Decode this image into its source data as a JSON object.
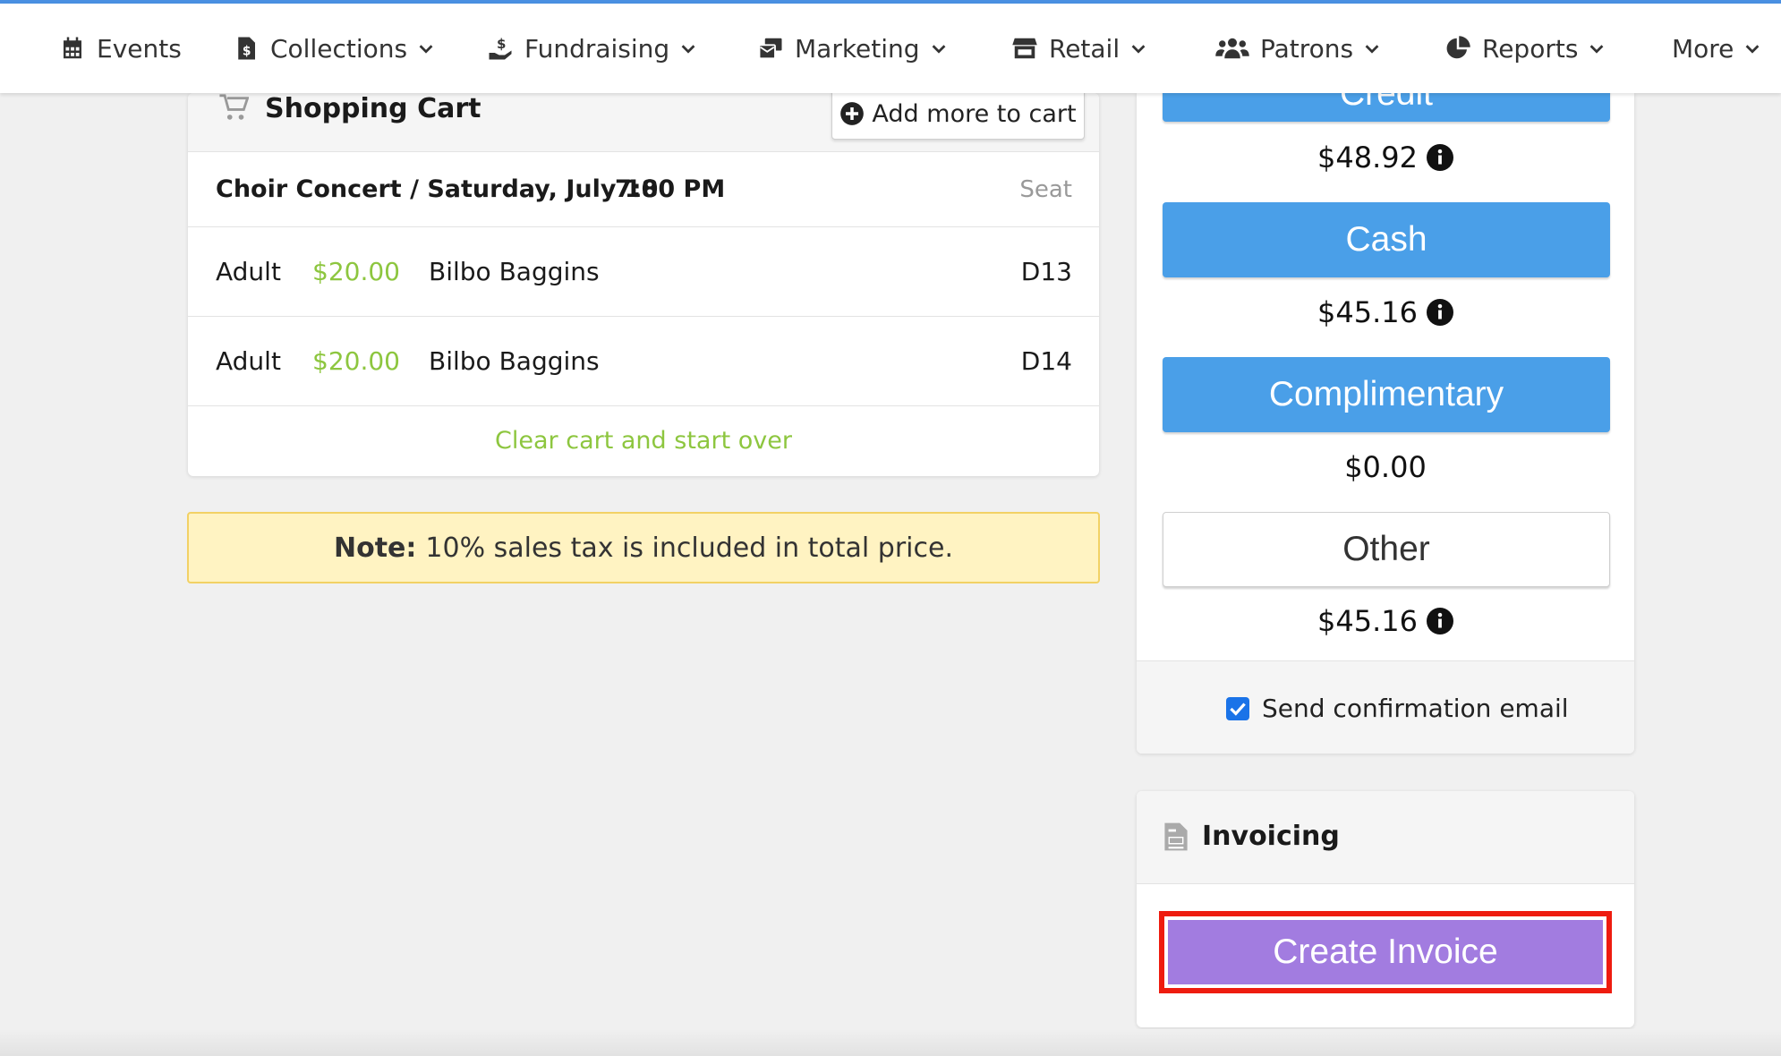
{
  "nav": {
    "items": [
      {
        "label": "Events",
        "icon": "calendar-icon"
      },
      {
        "label": "Collections",
        "icon": "dollar-file-icon"
      },
      {
        "label": "Fundraising",
        "icon": "donate-hand-icon"
      },
      {
        "label": "Marketing",
        "icon": "mail-bulk-icon"
      },
      {
        "label": "Retail",
        "icon": "store-icon"
      },
      {
        "label": "Patrons",
        "icon": "users-icon"
      },
      {
        "label": "Reports",
        "icon": "pie-chart-icon"
      },
      {
        "label": "More",
        "icon": "chevron-down-icon"
      }
    ]
  },
  "cart": {
    "title": "Shopping Cart",
    "add_more_label": "Add more to cart",
    "event": {
      "title": "Choir Concert / Saturday, July 18",
      "time": "7:00 PM",
      "seat_header": "Seat"
    },
    "tickets": [
      {
        "type": "Adult",
        "price": "$20.00",
        "patron": "Bilbo Baggins",
        "seat": "D13"
      },
      {
        "type": "Adult",
        "price": "$20.00",
        "patron": "Bilbo Baggins",
        "seat": "D14"
      }
    ],
    "clear_label": "Clear cart and start over"
  },
  "note": {
    "bold": "Note:",
    "text": "10% sales tax is included in total price."
  },
  "payment": {
    "credit_label": "Credit",
    "credit_amount": "$48.92",
    "cash_label": "Cash",
    "cash_amount": "$45.16",
    "comp_label": "Complimentary",
    "comp_amount": "$0.00",
    "other_label": "Other",
    "other_amount": "$45.16",
    "confirm_label": "Send confirmation email"
  },
  "invoicing": {
    "title": "Invoicing",
    "button_label": "Create Invoice"
  },
  "colors": {
    "accent": "#4a9fe8",
    "price_green": "#8dc63f",
    "invoice_purple": "#a27ce0",
    "highlight_red": "#ee1c0f",
    "note_bg": "#fff3c2"
  }
}
